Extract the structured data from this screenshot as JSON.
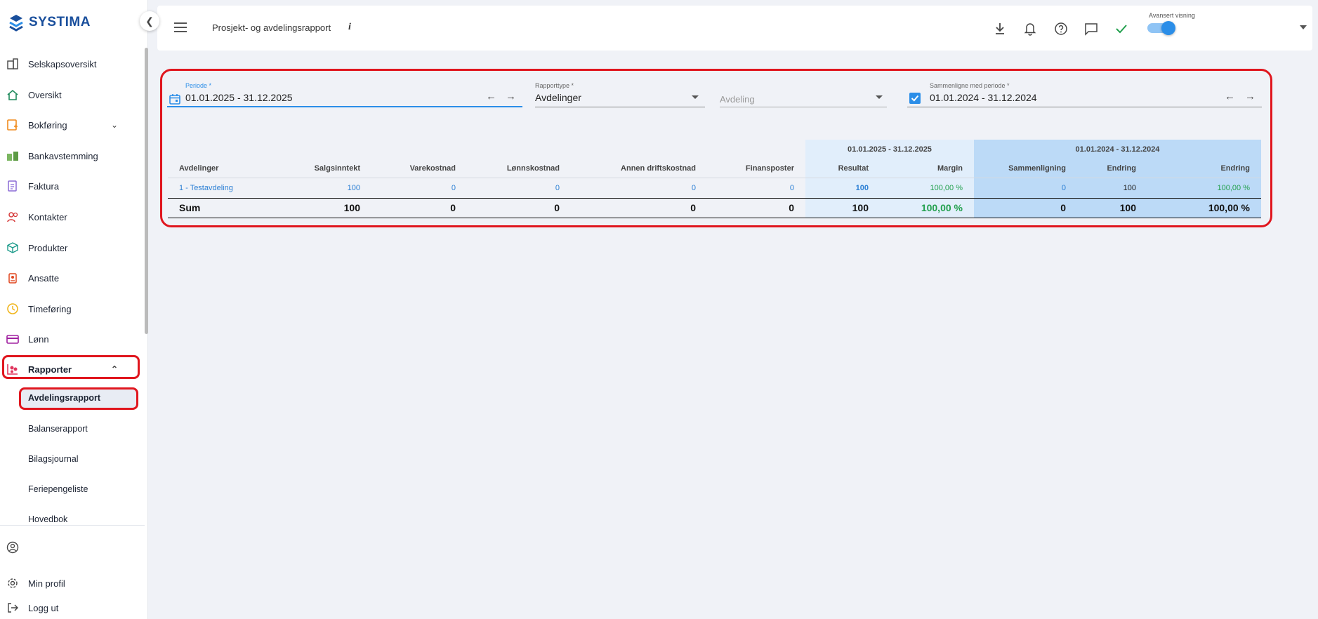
{
  "app": {
    "brand": "SYSTIMA"
  },
  "sidebar": {
    "items": [
      {
        "label": "Selskapsoversikt",
        "icon": "building-icon"
      },
      {
        "label": "Oversikt",
        "icon": "home-icon"
      },
      {
        "label": "Bokføring",
        "icon": "ledger-icon"
      },
      {
        "label": "Bankavstemming",
        "icon": "bank-reconcile-icon"
      },
      {
        "label": "Faktura",
        "icon": "invoice-icon"
      },
      {
        "label": "Kontakter",
        "icon": "contacts-icon"
      },
      {
        "label": "Produkter",
        "icon": "cube-icon"
      },
      {
        "label": "Ansatte",
        "icon": "badge-icon"
      },
      {
        "label": "Timeføring",
        "icon": "clock-icon"
      },
      {
        "label": "Lønn",
        "icon": "card-icon"
      },
      {
        "label": "Rapporter",
        "icon": "reports-icon"
      }
    ],
    "sub_items": [
      {
        "label": "Avdelingsrapport"
      },
      {
        "label": "Balanserapport"
      },
      {
        "label": "Bilagsjournal"
      },
      {
        "label": "Feriepengeliste"
      },
      {
        "label": "Hovedbok"
      }
    ],
    "bottom_items": [
      {
        "label": "Min profil",
        "icon": "gear-icon"
      },
      {
        "label": "Logg ut",
        "icon": "logout-icon"
      }
    ]
  },
  "topbar": {
    "title": "Prosjekt- og avdelingsrapport",
    "info": "i",
    "advanced_view_label": "Avansert visning",
    "advanced_view_on": true
  },
  "filters": {
    "period_label": "Periode *",
    "period_value": "01.01.2025 - 31.12.2025",
    "report_type_label": "Rapporttype *",
    "report_type_value": "Avdelinger",
    "department_placeholder": "Avdeling",
    "compare_label": "Sammenligne med periode *",
    "compare_value": "01.01.2024 - 31.12.2024",
    "compare_checked": true
  },
  "table": {
    "group_a": "01.01.2025 - 31.12.2025",
    "group_b": "01.01.2024 - 31.12.2024",
    "columns": [
      "Avdelinger",
      "Salgsinntekt",
      "Varekostnad",
      "Lønnskostnad",
      "Annen driftskostnad",
      "Finansposter",
      "Resultat",
      "Margin",
      "Sammenligning",
      "Endring",
      "Endring"
    ],
    "rows": [
      [
        "1 - Testavdeling",
        "100",
        "0",
        "0",
        "0",
        "0",
        "100",
        "100,00 %",
        "0",
        "100",
        "100,00 %"
      ]
    ],
    "sum": [
      "Sum",
      "100",
      "0",
      "0",
      "0",
      "0",
      "100",
      "100,00 %",
      "0",
      "100",
      "100,00 %"
    ]
  },
  "colors": {
    "accent": "#2b8ee8",
    "highlight": "#e0161e",
    "positive": "#23a04e"
  }
}
